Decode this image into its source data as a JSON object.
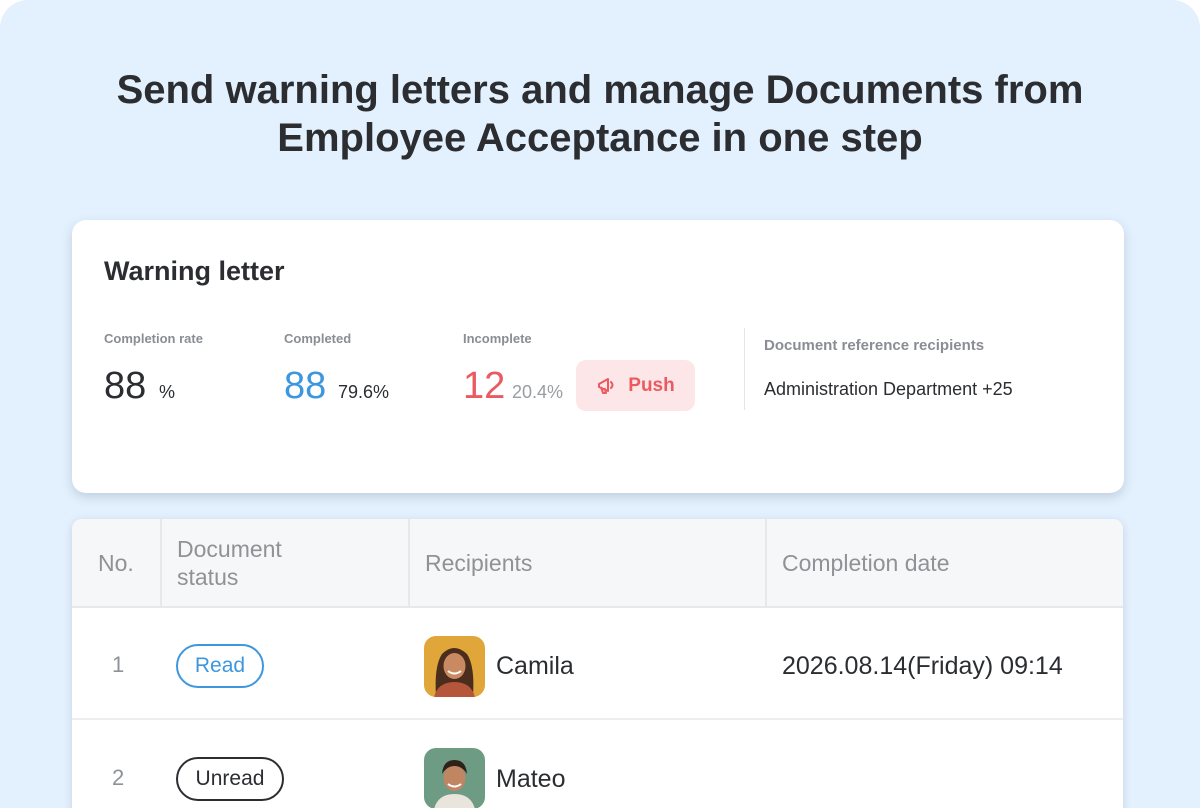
{
  "headline": {
    "line1": "Send warning letters and manage Documents from",
    "line2": "Employee Acceptance in one step"
  },
  "card": {
    "title": "Warning letter",
    "completion_rate": {
      "label": "Completion rate",
      "value": "88",
      "unit": "%"
    },
    "completed": {
      "label": "Completed",
      "value": "88",
      "percent": "79.6%"
    },
    "incomplete": {
      "label": "Incomplete",
      "value": "12",
      "percent": "20.4%"
    },
    "push_label": "Push",
    "reference": {
      "label": "Document reference recipients",
      "value": "Administration Department +25"
    }
  },
  "table": {
    "headers": {
      "no": "No.",
      "status_line1": "Document",
      "status_line2": "status",
      "recipients": "Recipients",
      "completion_date": "Completion date"
    },
    "rows": [
      {
        "no": "1",
        "status": "Read",
        "recipient": "Camila",
        "date": "2026.08.14(Friday) 09:14"
      },
      {
        "no": "2",
        "status": "Unread",
        "recipient": "Mateo",
        "date": ""
      }
    ]
  },
  "colors": {
    "background": "#e3f0fd",
    "completed_blue": "#3d97de",
    "incomplete_red": "#eb5a61",
    "push_bg": "#fde6e7",
    "text_dark": "#2b2d31",
    "text_muted": "#8a8d93"
  },
  "icons": {
    "push": "megaphone-icon"
  }
}
